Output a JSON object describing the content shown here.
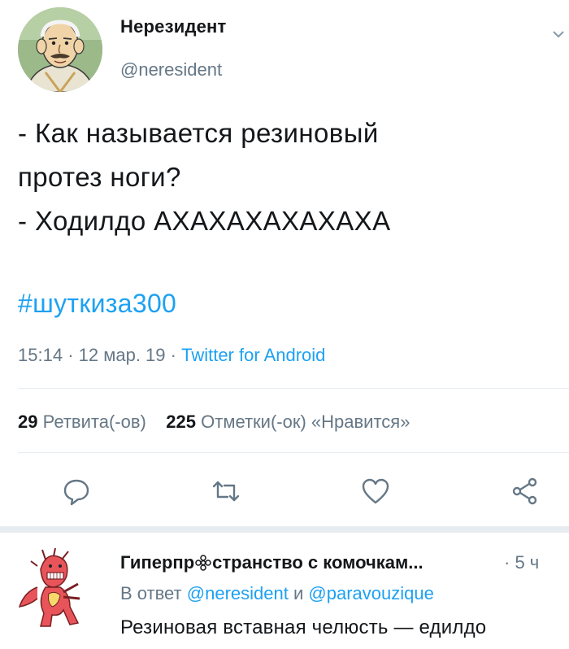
{
  "tweet": {
    "author_name": "Нерезидент",
    "author_handle": "@neresident",
    "lines": [
      "- Как называется резиновый",
      "протез ноги?",
      "- Ходилдо АХАХАХАХАХАХА"
    ],
    "hashtag": "#шуткиза300",
    "time": "15:14",
    "date": "12 мар. 19",
    "source": "Twitter for Android",
    "dot_sep": "·",
    "retweets_count": "29",
    "retweets_label": "Ретвита(-ов)",
    "likes_count": "225",
    "likes_label": "Отметки(-ок) «Нравится»"
  },
  "icons": {
    "menu": "chevron-down-icon",
    "reply": "reply-icon",
    "retweet": "retweet-icon",
    "like": "heart-icon",
    "share": "share-icon"
  },
  "reply": {
    "author_name_pre": "Гиперпр",
    "author_name_post": "странство с комочкам...",
    "time": "· 5 ч",
    "in_reply_to_label": "В ответ",
    "mention1": "@neresident",
    "conj": "и",
    "mention2": "@paravouzique",
    "text": "Резиновая вставная челюсть — едилдо"
  },
  "colors": {
    "accent": "#1da1f2",
    "muted": "#657786",
    "text": "#14171a",
    "divider": "#e6ecf0"
  }
}
